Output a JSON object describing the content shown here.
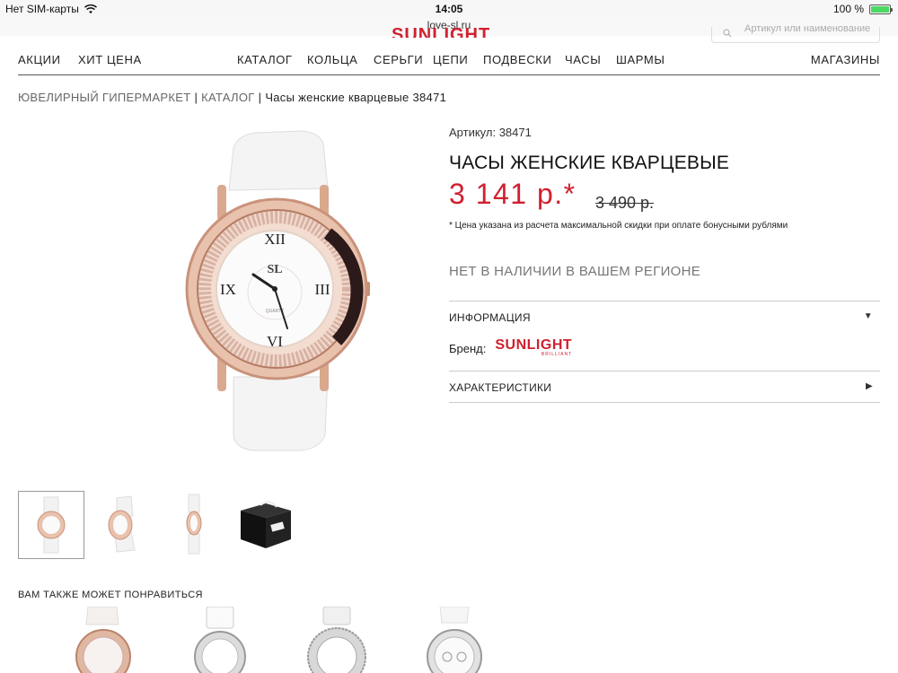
{
  "status_bar": {
    "carrier": "Нет SIM-карты",
    "time": "14:05",
    "battery_text": "100 %",
    "battery_level": 1.0
  },
  "browser": {
    "url": "love-sl.ru"
  },
  "header": {
    "brand": "SUNLIGHT",
    "search_placeholder": "Артикул или наименование"
  },
  "nav": {
    "items": [
      "АКЦИИ",
      "ХИТ ЦЕНА",
      "КАТАЛОГ",
      "КОЛЬЦА",
      "СЕРЬГИ",
      "ЦЕПИ",
      "ПОДВЕСКИ",
      "ЧАСЫ",
      "ШАРМЫ",
      "МАГАЗИНЫ"
    ]
  },
  "breadcrumb": {
    "items": [
      "ЮВЕЛИРНЫЙ ГИПЕРМАРКЕТ",
      "КАТАЛОГ"
    ],
    "separator": "|",
    "current": "Часы женские кварцевые 38471"
  },
  "product": {
    "article": "Артикул: 38471",
    "title": "ЧАСЫ ЖЕНСКИЕ КВАРЦЕВЫЕ",
    "price": "3 141 р.*",
    "old_price": "3 490 р.",
    "price_note": "* Цена указана из расчета максимальной скидки при оплате бонусными рублями",
    "stock": "НЕТ В НАЛИЧИИ В ВАШЕМ РЕГИОНЕ",
    "info_label": "ИНФОРМАЦИЯ",
    "brand_label": "Бренд:",
    "brand_logo": "SUNLIGHT",
    "brand_logo_sub": "BRILLIANT",
    "specs_label": "ХАРАКТЕРИСТИКИ",
    "dial_brand": "SL",
    "dial_text": "QUARTZ",
    "accent_color": "#d1202f"
  },
  "recommendations": {
    "title": "ВАМ ТАКЖЕ МОЖЕТ ПОНРАВИТЬСЯ"
  }
}
